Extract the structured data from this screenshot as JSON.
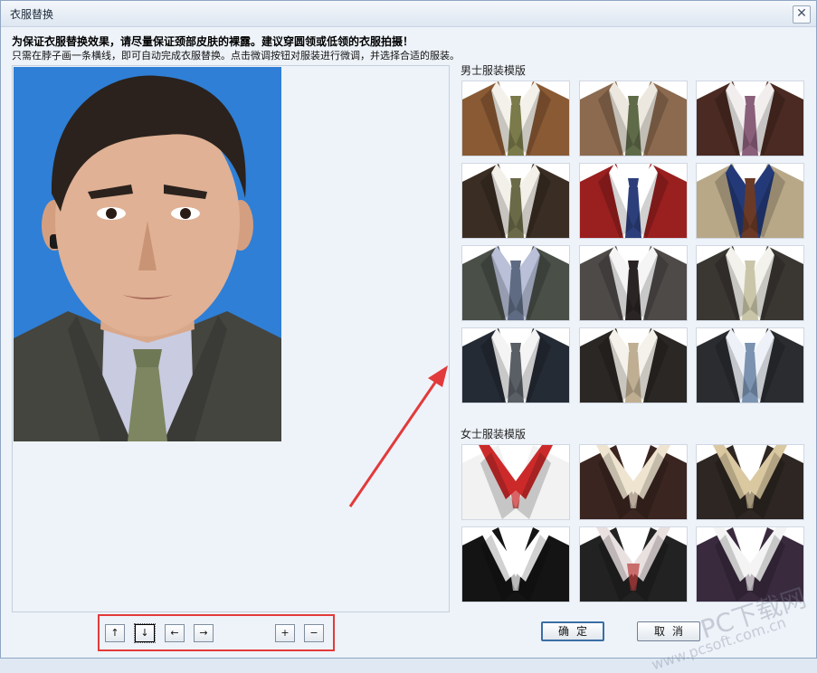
{
  "window": {
    "title": "衣服替换",
    "close_icon": "close-icon"
  },
  "instructions": {
    "line1": "为保证衣服替换效果，请尽量保证颈部皮肤的裸露。建议穿圆领或低领的衣服拍摄！",
    "line2": "只需在脖子画一条横线，即可自动完成衣服替换。点击微调按钮对服装进行微调，并选择合适的服装。"
  },
  "male": {
    "title": "男士服装模版",
    "tiles": [
      {
        "suit": "#8a5a34",
        "shirt": "#f4f1ea",
        "tie": "#7a7a4a"
      },
      {
        "suit": "#8c6a4f",
        "shirt": "#ede8df",
        "tie": "#5f6a48"
      },
      {
        "suit": "#4a2a22",
        "shirt": "#f2eeee",
        "tie": "#8a5f7a"
      },
      {
        "suit": "#3a2e24",
        "shirt": "#f3f0ea",
        "tie": "#6b6a48"
      },
      {
        "suit": "#9a1f1f",
        "shirt": "#ffffff",
        "tie": "#2d3f7a"
      },
      {
        "suit": "#b8a888",
        "shirt": "#243a78",
        "tie": "#6a3a26"
      },
      {
        "suit": "#4a4f48",
        "shirt": "#b9c0d8",
        "tie": "#5f6b82"
      },
      {
        "suit": "#4e4a48",
        "shirt": "#f5f5f5",
        "tie": "#2a2424"
      },
      {
        "suit": "#3a3632",
        "shirt": "#f3f2ec",
        "tie": "#c9c5a8"
      },
      {
        "suit": "#252b35",
        "shirt": "#f4f4f4",
        "tie": "#5a5f66"
      },
      {
        "suit": "#2a2724",
        "shirt": "#f4f2ea",
        "tie": "#bfae92"
      },
      {
        "suit": "#2a2c30",
        "shirt": "#eef2f8",
        "tie": "#7b92b0"
      }
    ]
  },
  "female": {
    "title": "女士服装模版",
    "tiles": [
      {
        "suit": "#f2f2f2",
        "shirt": "#cc2a2a",
        "tie": "#cc2a2a"
      },
      {
        "suit": "#3a2520",
        "shirt": "#efe4d0",
        "tie": "#efe4d0"
      },
      {
        "suit": "#2e2622",
        "shirt": "#d9c8a0",
        "tie": "#d9c8a0"
      },
      {
        "suit": "#141414",
        "shirt": "#ffffff",
        "tie": "#ffffff"
      },
      {
        "suit": "#222222",
        "shirt": "#e9e0e0",
        "tie": "#b93a3a"
      },
      {
        "suit": "#3a2a3e",
        "shirt": "#f4f4f4",
        "tie": "#f4f4f4"
      }
    ]
  },
  "controls": {
    "up": "↑",
    "down": "↓",
    "left": "←",
    "right": "→",
    "zoom_in": "+",
    "zoom_out": "−"
  },
  "buttons": {
    "ok": "确定",
    "cancel": "取消"
  },
  "colors": {
    "photo_bg": "#2f7fd6",
    "highlight": "#e23a3a"
  },
  "watermark": {
    "line1": "PC下载网",
    "line2": "www.pcsoft.com.cn"
  }
}
